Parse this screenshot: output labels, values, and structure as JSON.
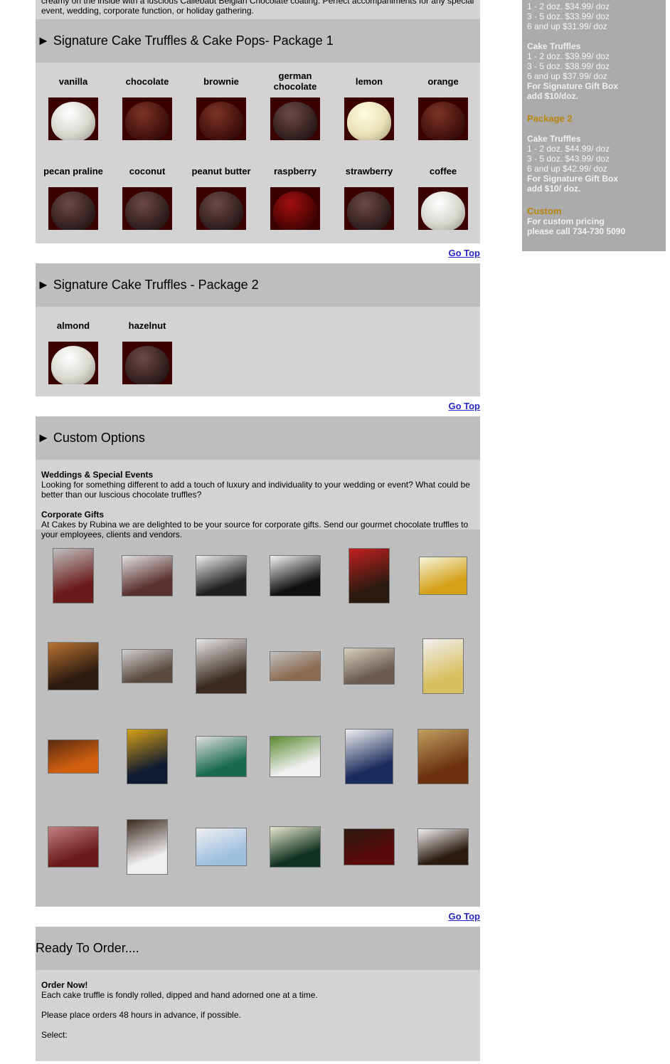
{
  "intro": {
    "line1": "creamy on the inside with a luscious Callebaut Belgian Chocolate coating. Perfect accompaniments for any special",
    "line2": "event, wedding, corporate function, or holiday gathering."
  },
  "package1": {
    "header": "► Signature Cake Truffles & Cake Pops- Package 1",
    "flavors": [
      "vanilla",
      "chocolate",
      "brownie",
      "german chocolate",
      "lemon",
      "orange",
      "pecan praline",
      "coconut",
      "peanut butter",
      "raspberry",
      "strawberry",
      "coffee"
    ]
  },
  "package2": {
    "header": "► Signature Cake Truffles - Package 2",
    "flavors": [
      "almond",
      "hazelnut"
    ]
  },
  "custom": {
    "header": "► Custom Options",
    "weddings_title": "Weddings & Special Events",
    "weddings_text": "Looking for something different to add a touch of luxury and individuality to your wedding or event? What could be better than our luscious chocolate truffles?",
    "corporate_title": "Corporate Gifts",
    "corporate_text": "At Cakes by Rubina we are delighted to be your source for corporate gifts. Send our gourmet chocolate truffles to your employees, clients and vendors."
  },
  "order": {
    "header": "Ready To Order....",
    "title": "Order Now!",
    "line1": "Each cake truffle is fondly rolled, dipped and hand adorned one at a time.",
    "line2": "Please place orders 48 hours in advance, if possible.",
    "select_label": "Select:"
  },
  "go_top": "Go Top",
  "sidebar": {
    "p1_prices": [
      "1 - 2 doz. $34.99/ doz",
      "3 - 5 doz. $33.99/ doz",
      "6 and up $31.99/ doz"
    ],
    "p1_truffles_title": "Cake Truffles",
    "p1_truffle_prices": [
      "1 - 2 doz. $39.99/ doz",
      "3 - 5 doz. $38.99/ doz",
      "6 and up $37.99/ doz"
    ],
    "p1_gift_box": [
      "For Signature Gift Box",
      "add $10/doz."
    ],
    "package2_title": "Package 2",
    "p2_truffles_title": "Cake Truffles",
    "p2_prices": [
      "1 - 2 doz. $44.99/ doz",
      "3 - 5 doz. $43.99/ doz",
      "6 and up $42.99/ doz"
    ],
    "p2_gift_box": [
      "For Signature Gift Box",
      "add $10/ doz."
    ],
    "custom_title": "Custom",
    "custom_lines": [
      "For custom pricing",
      "please call 734-730 5090"
    ]
  }
}
